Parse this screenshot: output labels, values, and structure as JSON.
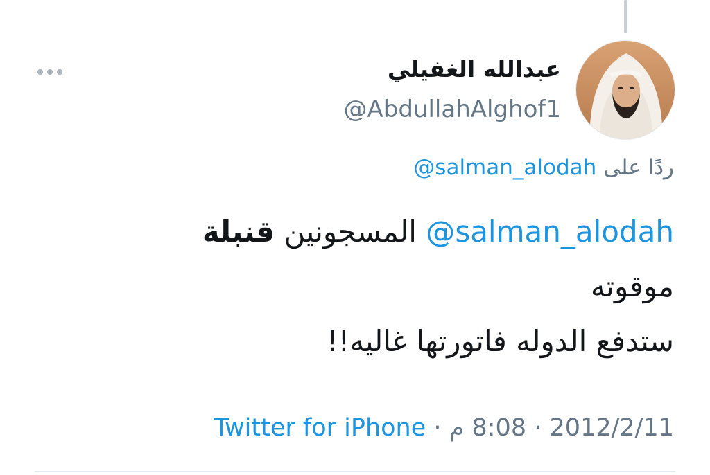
{
  "tweet": {
    "author": {
      "display_name": "عبدالله الغفيلي",
      "handle": "@AbdullahAlghof1",
      "avatar_icon": "profile-avatar"
    },
    "more_icon": "more-options-icon",
    "reply": {
      "prefix": "ردًا على",
      "handle": "@salman_alodah"
    },
    "text": {
      "mention": "@salman_alodah",
      "word_1": "المسجونين",
      "word_bold": "قنبلة",
      "line_2": "موقوته",
      "line_3": "ستدفع الدوله فاتورتها غاليه!!"
    },
    "meta": {
      "date": "2012/2/11",
      "separator": "·",
      "time": "8:08 م",
      "source": "Twitter for iPhone"
    }
  },
  "colors": {
    "link": "#1b95e0",
    "secondary_text": "#657786",
    "primary_text": "#14171a",
    "divider": "#e6ecf0"
  }
}
